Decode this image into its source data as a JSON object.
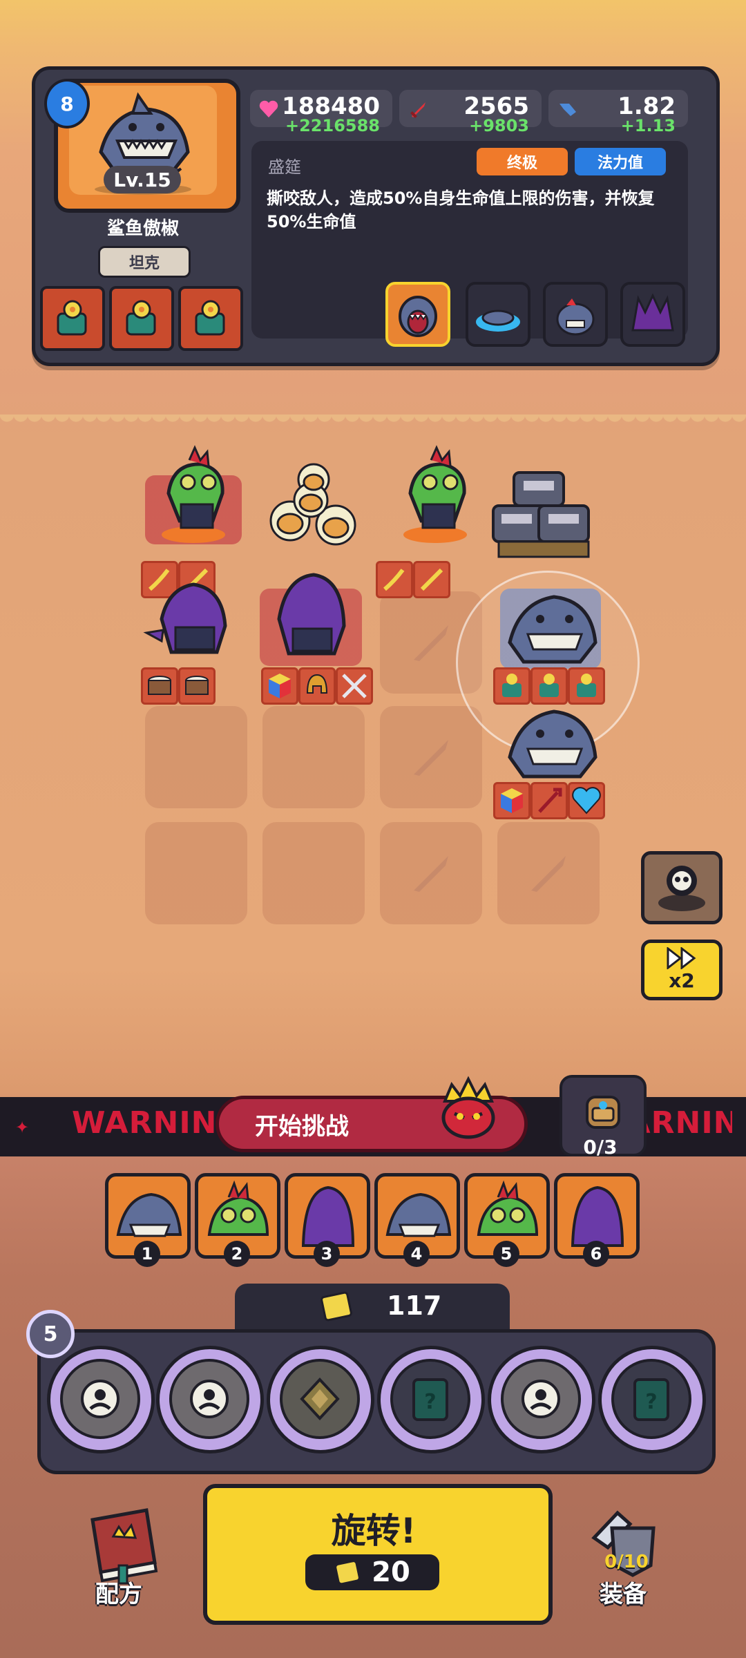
{
  "hero": {
    "drop_level": "8",
    "level": "Lv.15",
    "name": "鲨鱼傲椒",
    "role": "坦克",
    "stats": {
      "hp": "188480",
      "hp_bonus": "+2216588",
      "atk": "2565",
      "atk_bonus": "+9803",
      "spd": "1.82",
      "spd_bonus": "+1.13"
    },
    "skill": {
      "name": "盛筵",
      "tag_tier": "终极",
      "tag_cost": "法力值",
      "description": "撕咬敌人，造成50%自身生命值上限的伤害，并恢复50%生命值"
    }
  },
  "battle": {
    "speed_label": "x2",
    "warning_text": "WARNING",
    "start_label": "开始挑战",
    "bag_count": "0/3"
  },
  "roster": [
    {
      "num": "1"
    },
    {
      "num": "2"
    },
    {
      "num": "3"
    },
    {
      "num": "4"
    },
    {
      "num": "5"
    },
    {
      "num": "6"
    }
  ],
  "gold": "117",
  "ring_level": "5",
  "spin": {
    "label": "旋转!",
    "cost": "20"
  },
  "nav": {
    "recipe": "配方",
    "equipment": "装备",
    "equipment_count": "0/10"
  },
  "colors": {
    "accent_yellow": "#f8d32e",
    "panel_dark": "#3a3a4a",
    "warning_red": "#d51d3a",
    "hp_pink": "#ff5ca8",
    "bonus_green": "#6ae26a"
  }
}
